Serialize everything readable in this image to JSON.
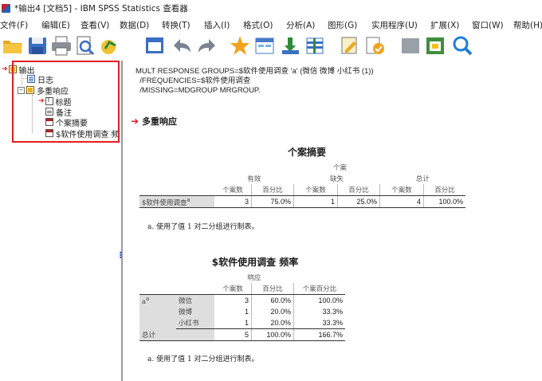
{
  "window": {
    "title": "*输出4 [文档5] - IBM SPSS Statistics 查看器"
  },
  "menu": [
    "文件(F)",
    "编辑(E)",
    "查看(V)",
    "数据(D)",
    "转换(T)",
    "插入(I)",
    "格式(O)",
    "分析(A)",
    "图形(G)",
    "实用程序(U)",
    "扩展(X)",
    "窗口(W)",
    "帮助(H)"
  ],
  "toolbar": {
    "icons": [
      "open-folder-icon",
      "save-icon",
      "print-icon",
      "print-preview-icon",
      "export-icon",
      "recall-dialog-icon",
      "undo-icon",
      "redo-icon",
      "goto-case-icon",
      "goto-variable-icon",
      "variables-icon",
      "designated-window-icon",
      "select-last-output-icon",
      "insert-heading-icon",
      "insert-text-icon",
      "designate-icon",
      "select-icon",
      "search-icon"
    ]
  },
  "navigator": {
    "root": "输出",
    "log": "日志",
    "group": "多重响应",
    "items": [
      "标题",
      "备注",
      "个案摘要",
      "$软件使用调查 频"
    ]
  },
  "syntax": [
    "MULT RESPONSE GROUPS=$软件使用调查 'a' (微信 微博 小红书 (1))",
    "  /FREQUENCIES=$软件使用调查",
    "  /MISSING=MDGROUP MRGROUP."
  ],
  "section_title": "多重响应",
  "case_summary": {
    "title": "个案摘要",
    "span_header": "个案",
    "groups": [
      "有效",
      "缺失",
      "总计"
    ],
    "cols": [
      "个案数",
      "百分比",
      "个案数",
      "百分比",
      "个案数",
      "百分比"
    ],
    "row_label": "$软件使用调查",
    "row_sup": "a",
    "values": [
      "3",
      "75.0%",
      "1",
      "25.0%",
      "4",
      "100.0%"
    ],
    "footnote": "a. 使用了值 1 对二分组进行制表。"
  },
  "frequency": {
    "title": "$软件使用调查 频率",
    "span_header": "响应",
    "cols": [
      "个案数",
      "百分比",
      "个案百分比"
    ],
    "group_label": "a",
    "group_sup": "a",
    "rows": [
      {
        "label": "微信",
        "n": "3",
        "pct": "60.0%",
        "case_pct": "100.0%"
      },
      {
        "label": "微博",
        "n": "1",
        "pct": "20.0%",
        "case_pct": "33.3%"
      },
      {
        "label": "小红书",
        "n": "1",
        "pct": "20.0%",
        "case_pct": "33.3%"
      }
    ],
    "total": {
      "label": "总计",
      "n": "5",
      "pct": "100.0%",
      "case_pct": "166.7%"
    },
    "footnote": "a. 使用了值 1 对二分组进行制表。"
  },
  "colors": {
    "highlight": "#e31e24",
    "accent": "#2a4fa8",
    "rowlabel_bg": "#dedede"
  }
}
